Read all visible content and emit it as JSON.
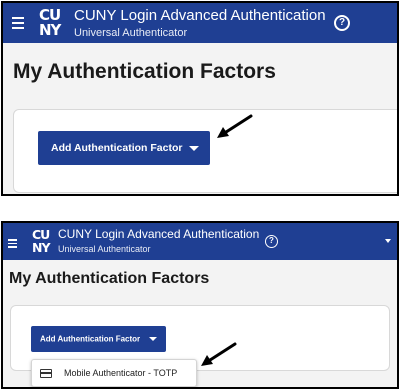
{
  "top_panel": {
    "app_title": "CUNY Login Advanced Authentication",
    "app_subtitle": "Universal Authenticator",
    "logo_line1": "CU",
    "logo_line2": "NY",
    "help_glyph": "?",
    "page_title": "My Authentication Factors",
    "add_button_label": "Add Authentication Factor"
  },
  "bottom_panel": {
    "app_title": "CUNY Login Advanced Authentication",
    "app_subtitle": "Universal Authenticator",
    "logo_line1": "CU",
    "logo_line2": "NY",
    "help_glyph": "?",
    "page_title": "My Authentication Factors",
    "add_button_label": "Add Authentication Factor",
    "dropdown_items": [
      {
        "label": "Mobile Authenticator - TOTP",
        "icon": "credit-card-icon"
      }
    ]
  },
  "colors": {
    "header_blue": "#1f3f93",
    "button_blue": "#1f3f93",
    "panel_background": "#f3f3f3",
    "arrow": "#000000"
  },
  "icons": {
    "menu": "hamburger-icon",
    "help": "help-circle-icon",
    "caret": "chevron-down-icon",
    "pointer": "arrow-icon"
  }
}
